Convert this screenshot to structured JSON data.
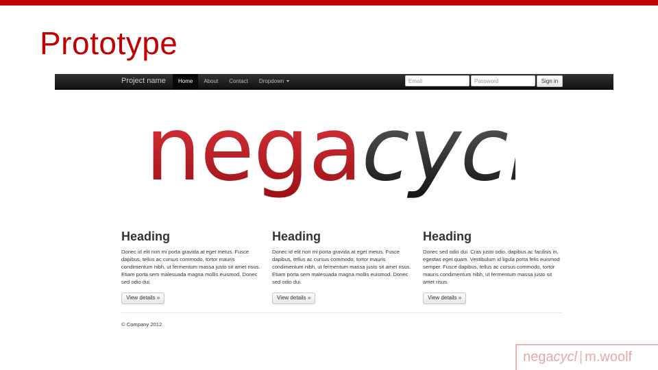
{
  "slide": {
    "title": "Prototype"
  },
  "navbar": {
    "brand": "Project name",
    "items": [
      {
        "label": "Home",
        "active": true
      },
      {
        "label": "About"
      },
      {
        "label": "Contact"
      },
      {
        "label": "Dropdown"
      }
    ],
    "email_placeholder": "Email",
    "password_placeholder": "Password",
    "signin_label": "Sign in"
  },
  "logo": {
    "part1": "nega",
    "part2": "cycl"
  },
  "columns": [
    {
      "heading": "Heading",
      "body": "Donec id elit non mi porta gravida at eget metus. Fusce dapibus, tellus ac cursus commodo, tortor mauris condimentum nibh, ut fermentum massa justo sit amet risus. Etiam porta sem malesuada magna mollis euismod. Donec sed odio dui.",
      "button": "View details »"
    },
    {
      "heading": "Heading",
      "body": "Donec id elit non mi porta gravida at eget metus. Fusce dapibus, tellus ac cursus commodo, tortor mauris condimentum nibh, ut fermentum massa justo sit amet risus. Etiam porta sem malesuada magna mollis euismod. Donec sed odio dui.",
      "button": "View details »"
    },
    {
      "heading": "Heading",
      "body": "Donec sed odio dui. Cras justo odio, dapibus ac facilisis in, egestas eget quam. Vestibulum id ligula porta felis euismod semper. Fusce dapibus, tellus ac cursus commodo, tortor mauris condimentum nibh, ut fermentum massa justo sit amet risus.",
      "button": "View details »"
    }
  ],
  "footer": {
    "text": "© Company 2012"
  },
  "watermark": {
    "brand_part1": "nega",
    "brand_part2": "cycl",
    "author": "m.woolf"
  },
  "colors": {
    "accent": "#c00000",
    "logo_red": "#c7161d",
    "logo_dark": "#222222",
    "navbar": "#1b1b1b"
  }
}
